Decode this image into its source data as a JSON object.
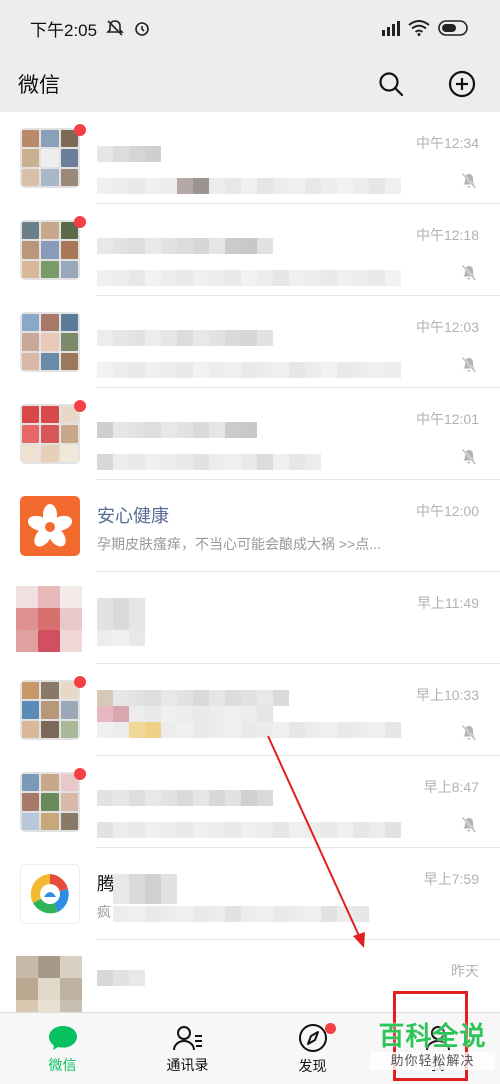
{
  "status": {
    "time": "下午2:05"
  },
  "header": {
    "title": "微信"
  },
  "chats": [
    {
      "time": "中午12:34",
      "muted": true,
      "unread": true
    },
    {
      "time": "中午12:18",
      "muted": true,
      "unread": true
    },
    {
      "time": "中午12:03",
      "muted": true,
      "unread": false
    },
    {
      "time": "中午12:01",
      "muted": true,
      "unread": true
    },
    {
      "name": "安心健康",
      "preview": "孕期皮肤瘙痒，不当心可能会酿成大祸 >>点...",
      "time": "中午12:00",
      "muted": false,
      "unread": false
    },
    {
      "time": "早上11:49",
      "muted": false,
      "unread": false
    },
    {
      "time": "早上10:33",
      "muted": true,
      "unread": true
    },
    {
      "time": "早上8:47",
      "muted": true,
      "unread": true
    },
    {
      "name_fragment": "腾",
      "preview_fragment": "疯",
      "time": "早上7:59",
      "muted": false,
      "unread": false
    },
    {
      "time": "昨天",
      "muted": false,
      "unread": false
    }
  ],
  "tabs": [
    {
      "label": "微信",
      "active": true
    },
    {
      "label": "通讯录",
      "active": false
    },
    {
      "label": "发现",
      "active": false,
      "dot": true
    },
    {
      "label": "我",
      "active": false
    }
  ],
  "watermark": {
    "main": "百科全说",
    "sub": "助你轻松解决"
  },
  "colors": {
    "accent": "#07c160",
    "unread": "#f43f44",
    "service_name": "#576b95",
    "annotation": "#e02020"
  }
}
